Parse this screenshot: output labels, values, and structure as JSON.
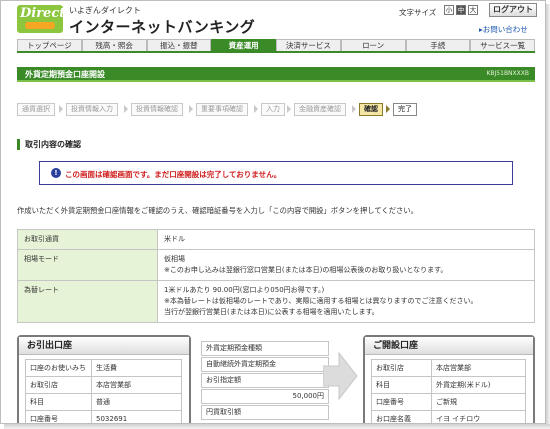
{
  "header": {
    "logo_text": "Direct",
    "logo_sub": "",
    "bank_sub": "いよぎんダイレクト",
    "bank_main": "インターネットバンキング",
    "font_size_label": "文字サイズ",
    "font_sizes": [
      "小",
      "中",
      "大"
    ],
    "logout_label": "ログアウト",
    "contact_label": "お問い合わせ"
  },
  "nav": {
    "items": [
      "トップページ",
      "残高・照会",
      "振込・振替",
      "資産運用",
      "決済サービス",
      "ローン",
      "手続",
      "サービス一覧"
    ],
    "active_index": 3
  },
  "title": {
    "text": "外貨定期預金口座開設",
    "code": "KBJ51BNXXXB"
  },
  "steps": [
    "通貨選択",
    "投資情報入力",
    "投資情報確認",
    "重要事項確認",
    "入力",
    "金融資産確認",
    "確認",
    "完了"
  ],
  "current_step_index": 6,
  "section_title": "取引内容の確認",
  "notice": {
    "icon": "!",
    "text": "この画面は確認画面です。まだ口座開設は完了しておりません。"
  },
  "instruction": "作成いただく外貨定期預金口座情報をご確認のうえ、確認暗証番号を入力し「この内容で開設」ボタンを押してください。",
  "info_table": [
    {
      "label": "お取引通貨",
      "lines": [
        "米ドル"
      ]
    },
    {
      "label": "相場モード",
      "lines": [
        "仮相場",
        "※このお申し込みは翌銀行窓口営業日(または本日)の相場公表後のお取り扱いとなります。"
      ]
    },
    {
      "label": "為替レート",
      "lines": [
        "1米ドルあたり 90.00円(窓口より050円お得です。)",
        "※本為替レートは仮相場のレートであり、実際に適用する相場とは異なりますのでご注意ください。",
        "当行が翌銀行営業日(または本日)に公表する相場を適用いたします。"
      ]
    }
  ],
  "left_panel": {
    "title": "お引出口座",
    "rows": [
      {
        "key": "口座のお使いみち",
        "value": "生活費"
      },
      {
        "key": "お取引店",
        "value": "本店営業部"
      },
      {
        "key": "科目",
        "value": "普通"
      },
      {
        "key": "口座番号",
        "value": "5032691"
      }
    ]
  },
  "middle": {
    "rows": [
      "外貨定期預金種類",
      "自動継続外貨定期預金",
      "お引指定額",
      "50,000円",
      "円貨取引額"
    ]
  },
  "right_panel": {
    "title": "ご開設口座",
    "rows": [
      {
        "key": "お取引店",
        "value": "本店営業部"
      },
      {
        "key": "科目",
        "value": "外貨定期(米ドル)"
      },
      {
        "key": "口座番号",
        "value": "ご新規"
      },
      {
        "key": "お口座名義",
        "value": "イヨ イチロウ"
      }
    ]
  },
  "colors": {
    "brand_green": "#3a8a27",
    "light_green": "#e6f3d6",
    "notice_red": "#d01c1c",
    "notice_blue": "#2a3f9b"
  }
}
